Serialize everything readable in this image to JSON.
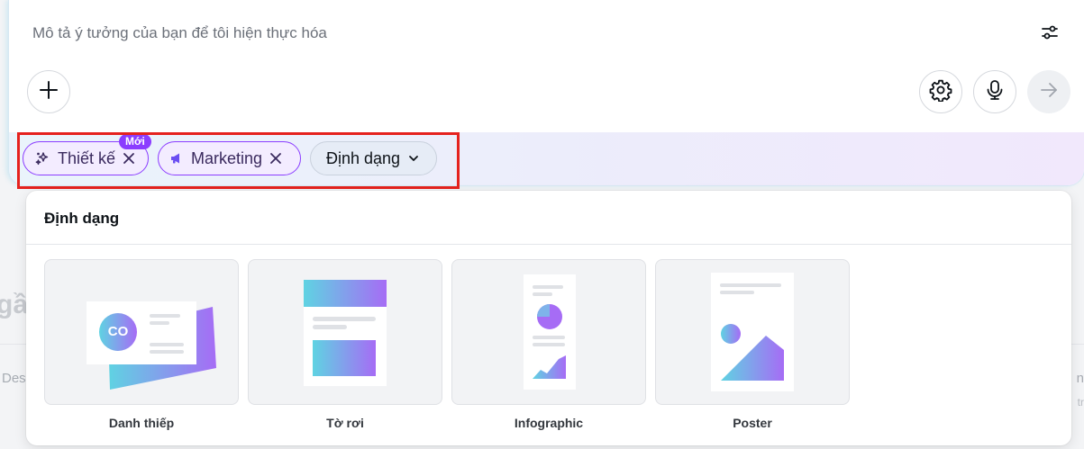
{
  "background": {
    "heading_fragment": "gầ",
    "left_fragment": "Des",
    "right_fragment": "n",
    "right_fragment2": "tr"
  },
  "prompt": {
    "placeholder": "Mô tả ý tưởng của bạn để tôi hiện thực hóa"
  },
  "chips": {
    "design_label": "Thiết kế",
    "design_badge": "Mới",
    "marketing_label": "Marketing",
    "format_label": "Định dạng"
  },
  "panel": {
    "title": "Định dạng",
    "options": [
      {
        "label": "Danh thiếp",
        "icon": "business-card-icon"
      },
      {
        "label": "Tờ rơi",
        "icon": "flyer-icon"
      },
      {
        "label": "Infographic",
        "icon": "infographic-icon"
      },
      {
        "label": "Poster",
        "icon": "poster-icon"
      }
    ],
    "card_logo_text": "CO"
  },
  "colors": {
    "accent": "#8b3dff",
    "highlight": "#e5221e",
    "gradient_start": "#5fd3e2",
    "gradient_end": "#a66cf5"
  }
}
